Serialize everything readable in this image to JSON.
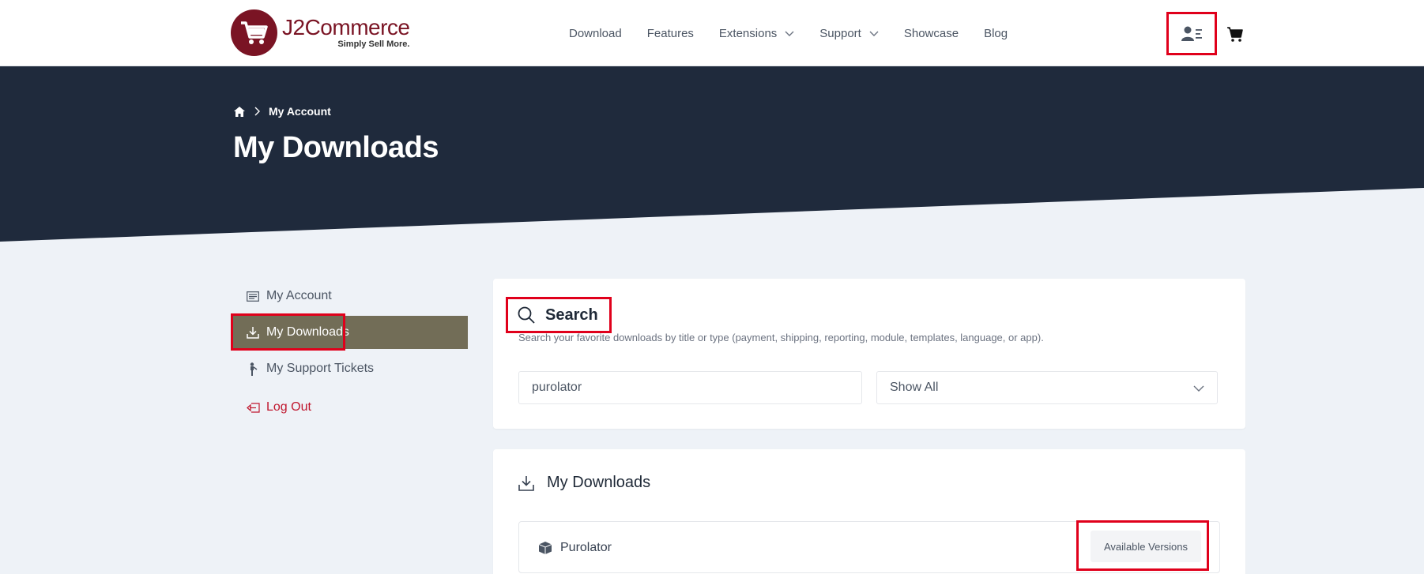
{
  "header": {
    "logo_name": "J2Commerce",
    "logo_tagline": "Simply Sell More.",
    "nav": [
      {
        "label": "Download",
        "has_dropdown": false
      },
      {
        "label": "Features",
        "has_dropdown": false
      },
      {
        "label": "Extensions",
        "has_dropdown": true
      },
      {
        "label": "Support",
        "has_dropdown": true
      },
      {
        "label": "Showcase",
        "has_dropdown": false
      },
      {
        "label": "Blog",
        "has_dropdown": false
      }
    ],
    "user_icon": "user-menu-icon",
    "cart_icon": "cart-icon"
  },
  "hero": {
    "breadcrumb_current": "My Account",
    "title": "My Downloads"
  },
  "sidebar": {
    "items": [
      {
        "label": "My Account",
        "icon": "account-list-icon",
        "active": false
      },
      {
        "label": "My Downloads",
        "icon": "download-icon",
        "active": true
      },
      {
        "label": "My Support Tickets",
        "icon": "support-person-icon",
        "active": false
      },
      {
        "label": "Log Out",
        "icon": "logout-icon",
        "active": false
      }
    ]
  },
  "search": {
    "title": "Search",
    "description": "Search your favorite downloads by title or type (payment, shipping, reporting, module, templates, language, or app).",
    "input_value": "purolator",
    "select_value": "Show All"
  },
  "downloads": {
    "title": "My Downloads",
    "items": [
      {
        "name": "Purolator",
        "action_label": "Available Versions"
      }
    ]
  },
  "colors": {
    "brand": "#7a1424",
    "hero_bg": "#1f2a3c",
    "active_sidebar": "#726d57",
    "highlight": "#e0001b",
    "logout": "#c0172e"
  }
}
